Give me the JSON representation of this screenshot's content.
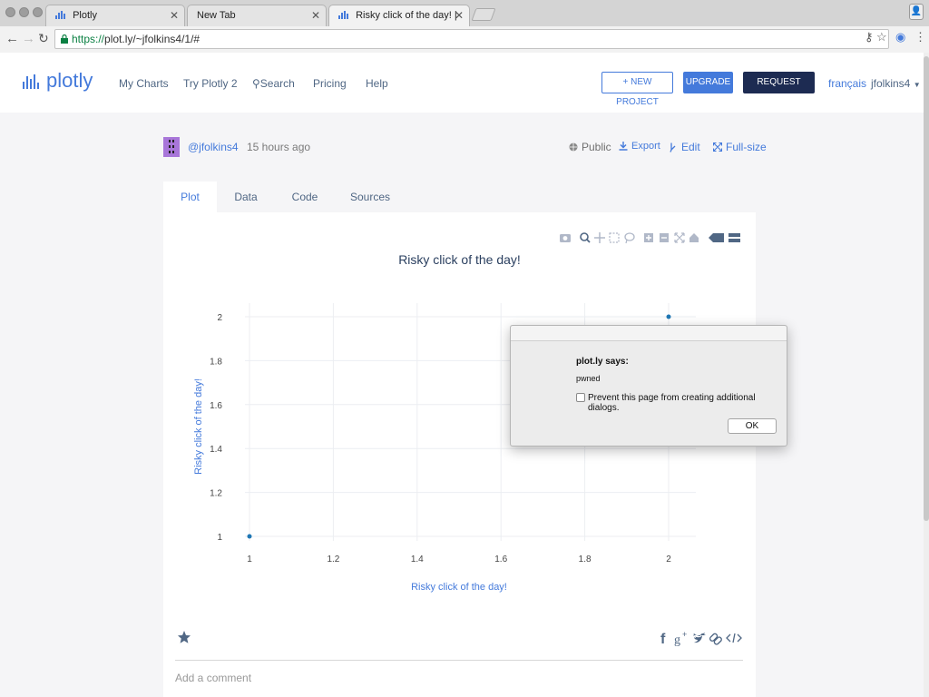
{
  "browser": {
    "tabs": [
      {
        "title": "Plotly"
      },
      {
        "title": "New Tab"
      },
      {
        "title": "Risky click of the day! | scatter"
      }
    ],
    "url_scheme": "https://",
    "url_rest": "plot.ly/~jfolkins4/1/#"
  },
  "site": {
    "logo_text": "plotly",
    "nav": [
      "My Charts",
      "Try Plotly 2",
      "Search",
      "Pricing",
      "Help"
    ],
    "new_project": "+ NEW PROJECT",
    "upgrade": "UPGRADE",
    "request_demo": "REQUEST DEMO",
    "language": "français",
    "user": "jfolkins4"
  },
  "post": {
    "author": "@jfolkins4",
    "time": "15 hours ago",
    "visibility": "Public",
    "export": "Export",
    "edit": "Edit",
    "fullsize": "Full-size"
  },
  "tabs": [
    "Plot",
    "Data",
    "Code",
    "Sources"
  ],
  "chart_data": {
    "type": "scatter",
    "title": "Risky click of the day!",
    "xlabel": "Risky click of the day!",
    "ylabel": "Risky click of the day!",
    "x": [
      1,
      2
    ],
    "y": [
      1,
      2
    ],
    "xlim": [
      1,
      2
    ],
    "ylim": [
      1,
      2
    ],
    "xticks": [
      "1",
      "1.2",
      "1.4",
      "1.6",
      "1.8",
      "2"
    ],
    "yticks": [
      "1",
      "1.2",
      "1.4",
      "1.6",
      "1.8",
      "2"
    ],
    "grid": true,
    "color": "#1f77b4"
  },
  "footer": {
    "comment_placeholder": "Add a comment"
  },
  "dialog": {
    "title": "plot.ly says:",
    "message": "pwned",
    "checkbox_label": "Prevent this page from creating additional dialogs.",
    "ok_label": "OK"
  }
}
